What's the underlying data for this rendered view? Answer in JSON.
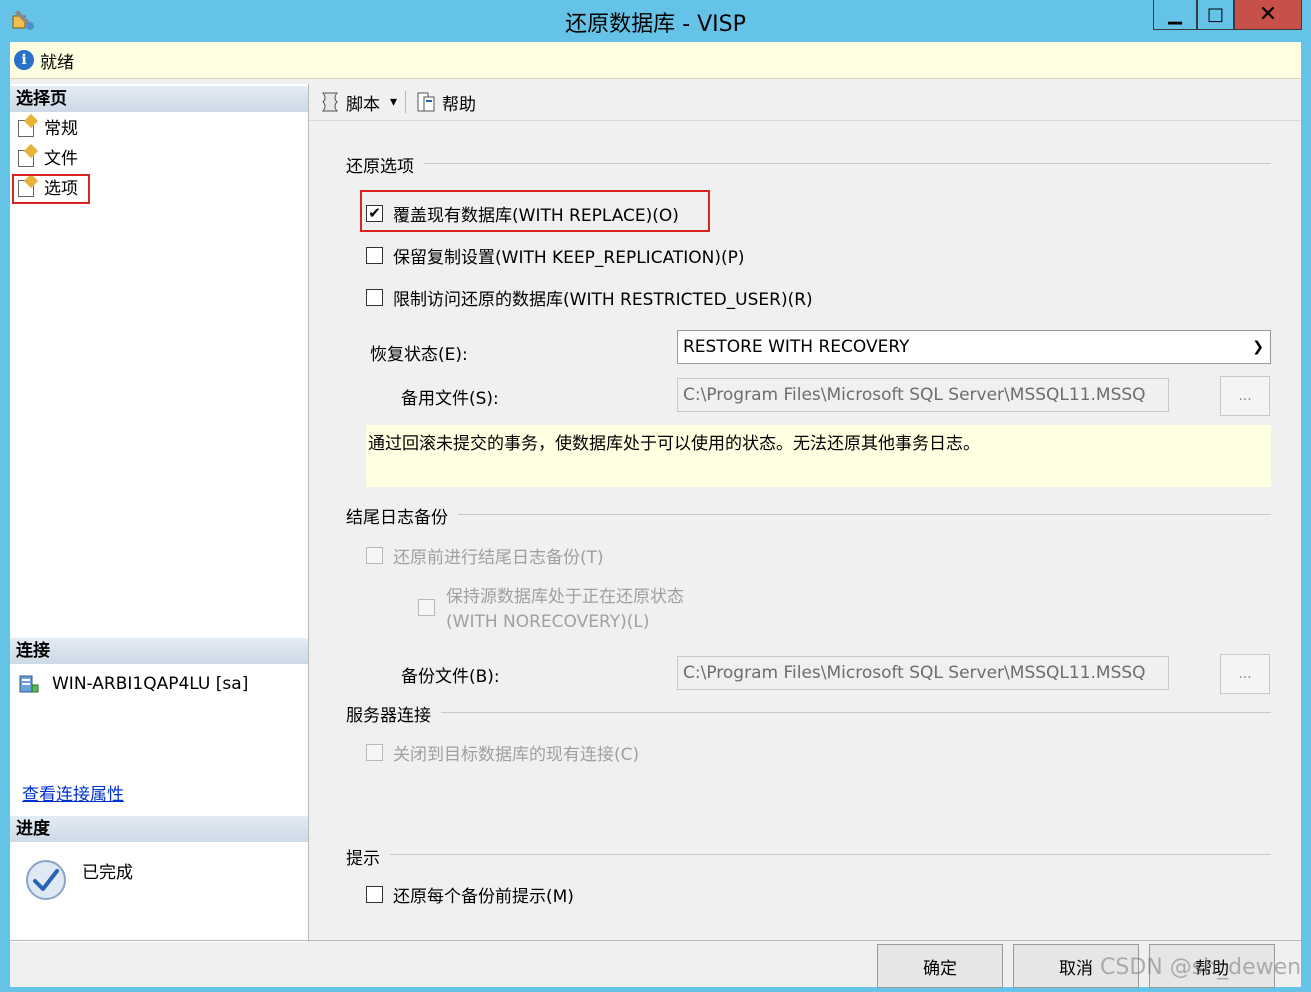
{
  "window": {
    "title": "还原数据库 - VISP",
    "min_glyph": "▁",
    "max_glyph": "□",
    "close_glyph": "✕"
  },
  "status": {
    "text": "就绪"
  },
  "left": {
    "select_page_header": "选择页",
    "nav": [
      {
        "label": "常规"
      },
      {
        "label": "文件"
      },
      {
        "label": "选项"
      }
    ],
    "connection_header": "连接",
    "server": "WIN-ARBI1QAP4LU [sa]",
    "view_connection_link": "查看连接属性",
    "progress_header": "进度",
    "progress_status": "已完成"
  },
  "toolbar": {
    "script_label": "脚本",
    "dropdown_glyph": "▾",
    "help_label": "帮助"
  },
  "restore_options": {
    "label": "还原选项",
    "overwrite": {
      "label": "覆盖现有数据库(WITH REPLACE)(O)",
      "checked": true
    },
    "keep_replication": {
      "label": "保留复制设置(WITH KEEP_REPLICATION)(P)",
      "checked": false
    },
    "restricted_user": {
      "label": "限制访问还原的数据库(WITH RESTRICTED_USER)(R)",
      "checked": false
    },
    "recovery_state_label": "恢复状态(E):",
    "recovery_state_value": "RESTORE WITH RECOVERY",
    "standby_file_label": "备用文件(S):",
    "standby_file_value": "C:\\Program Files\\Microsoft SQL Server\\MSSQL11.MSSQ",
    "ellipsis": "...",
    "info_text": "通过回滚未提交的事务，使数据库处于可以使用的状态。无法还原其他事务日志。"
  },
  "tail_log": {
    "label": "结尾日志备份",
    "take_tail_backup": {
      "label": "还原前进行结尾日志备份(T)",
      "checked": false
    },
    "leave_norecovery_line1": "保持源数据库处于正在还原状态",
    "leave_norecovery_line2": "(WITH NORECOVERY)(L)",
    "backup_file_label": "备份文件(B):",
    "backup_file_value": "C:\\Program Files\\Microsoft SQL Server\\MSSQL11.MSSQ",
    "ellipsis": "..."
  },
  "server_connection": {
    "label": "服务器连接",
    "close_existing": {
      "label": "关闭到目标数据库的现有连接(C)",
      "checked": false
    }
  },
  "prompt": {
    "label": "提示",
    "prompt_before_each": {
      "label": "还原每个备份前提示(M)",
      "checked": false
    }
  },
  "buttons": {
    "ok": "确定",
    "cancel": "取消",
    "help": "帮助"
  },
  "watermark": "CSDN @sh_dewen"
}
